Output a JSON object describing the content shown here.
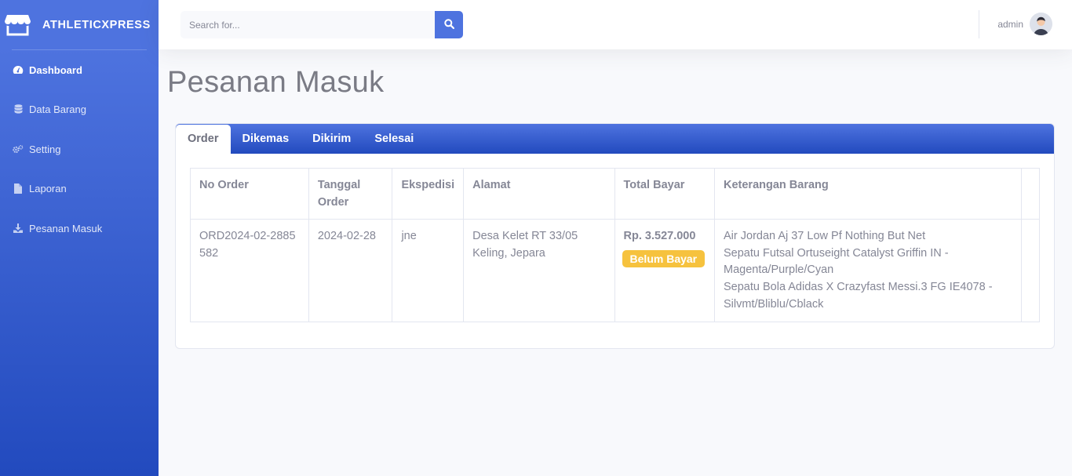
{
  "brand": {
    "name": "ATHLETICXPRESS",
    "icon": "store-icon"
  },
  "sidebar": {
    "items": [
      {
        "label": "Dashboard",
        "icon": "tachometer-icon",
        "active": true
      },
      {
        "label": "Data Barang",
        "icon": "database-icon",
        "active": false
      },
      {
        "label": "Setting",
        "icon": "cogs-icon",
        "active": false
      },
      {
        "label": "Laporan",
        "icon": "file-icon",
        "active": false
      },
      {
        "label": "Pesanan Masuk",
        "icon": "download-icon",
        "active": false
      }
    ]
  },
  "topbar": {
    "search_placeholder": "Search for...",
    "search_icon": "search-icon",
    "user_name": "admin"
  },
  "page": {
    "title": "Pesanan Masuk"
  },
  "tabs": [
    {
      "label": "Order",
      "active": true
    },
    {
      "label": "Dikemas",
      "active": false
    },
    {
      "label": "Dikirim",
      "active": false
    },
    {
      "label": "Selesai",
      "active": false
    }
  ],
  "table": {
    "headers": [
      "No Order",
      "Tanggal Order",
      "Ekspedisi",
      "Alamat",
      "Total Bayar",
      "Keterangan Barang",
      ""
    ],
    "rows": [
      {
        "no_order": "ORD2024-02-2885582",
        "tanggal": "2024-02-28",
        "ekspedisi": "jne",
        "alamat": "Desa Kelet RT 33/05 Keling, Jepara",
        "total": "Rp. 3.527.000",
        "status": "Belum Bayar",
        "items": [
          "Air Jordan Aj 37 Low Pf Nothing But Net",
          "Sepatu Futsal Ortuseight Catalyst Griffin IN - Magenta/Purple/Cyan",
          "Sepatu Bola Adidas X Crazyfast Messi.3 FG IE4078 - Silvmt/Bliblu/Cblack"
        ]
      }
    ]
  },
  "colors": {
    "primary": "#4e73df",
    "primary_dark": "#224abe",
    "warning": "#f6c23e",
    "text_muted": "#858796"
  }
}
